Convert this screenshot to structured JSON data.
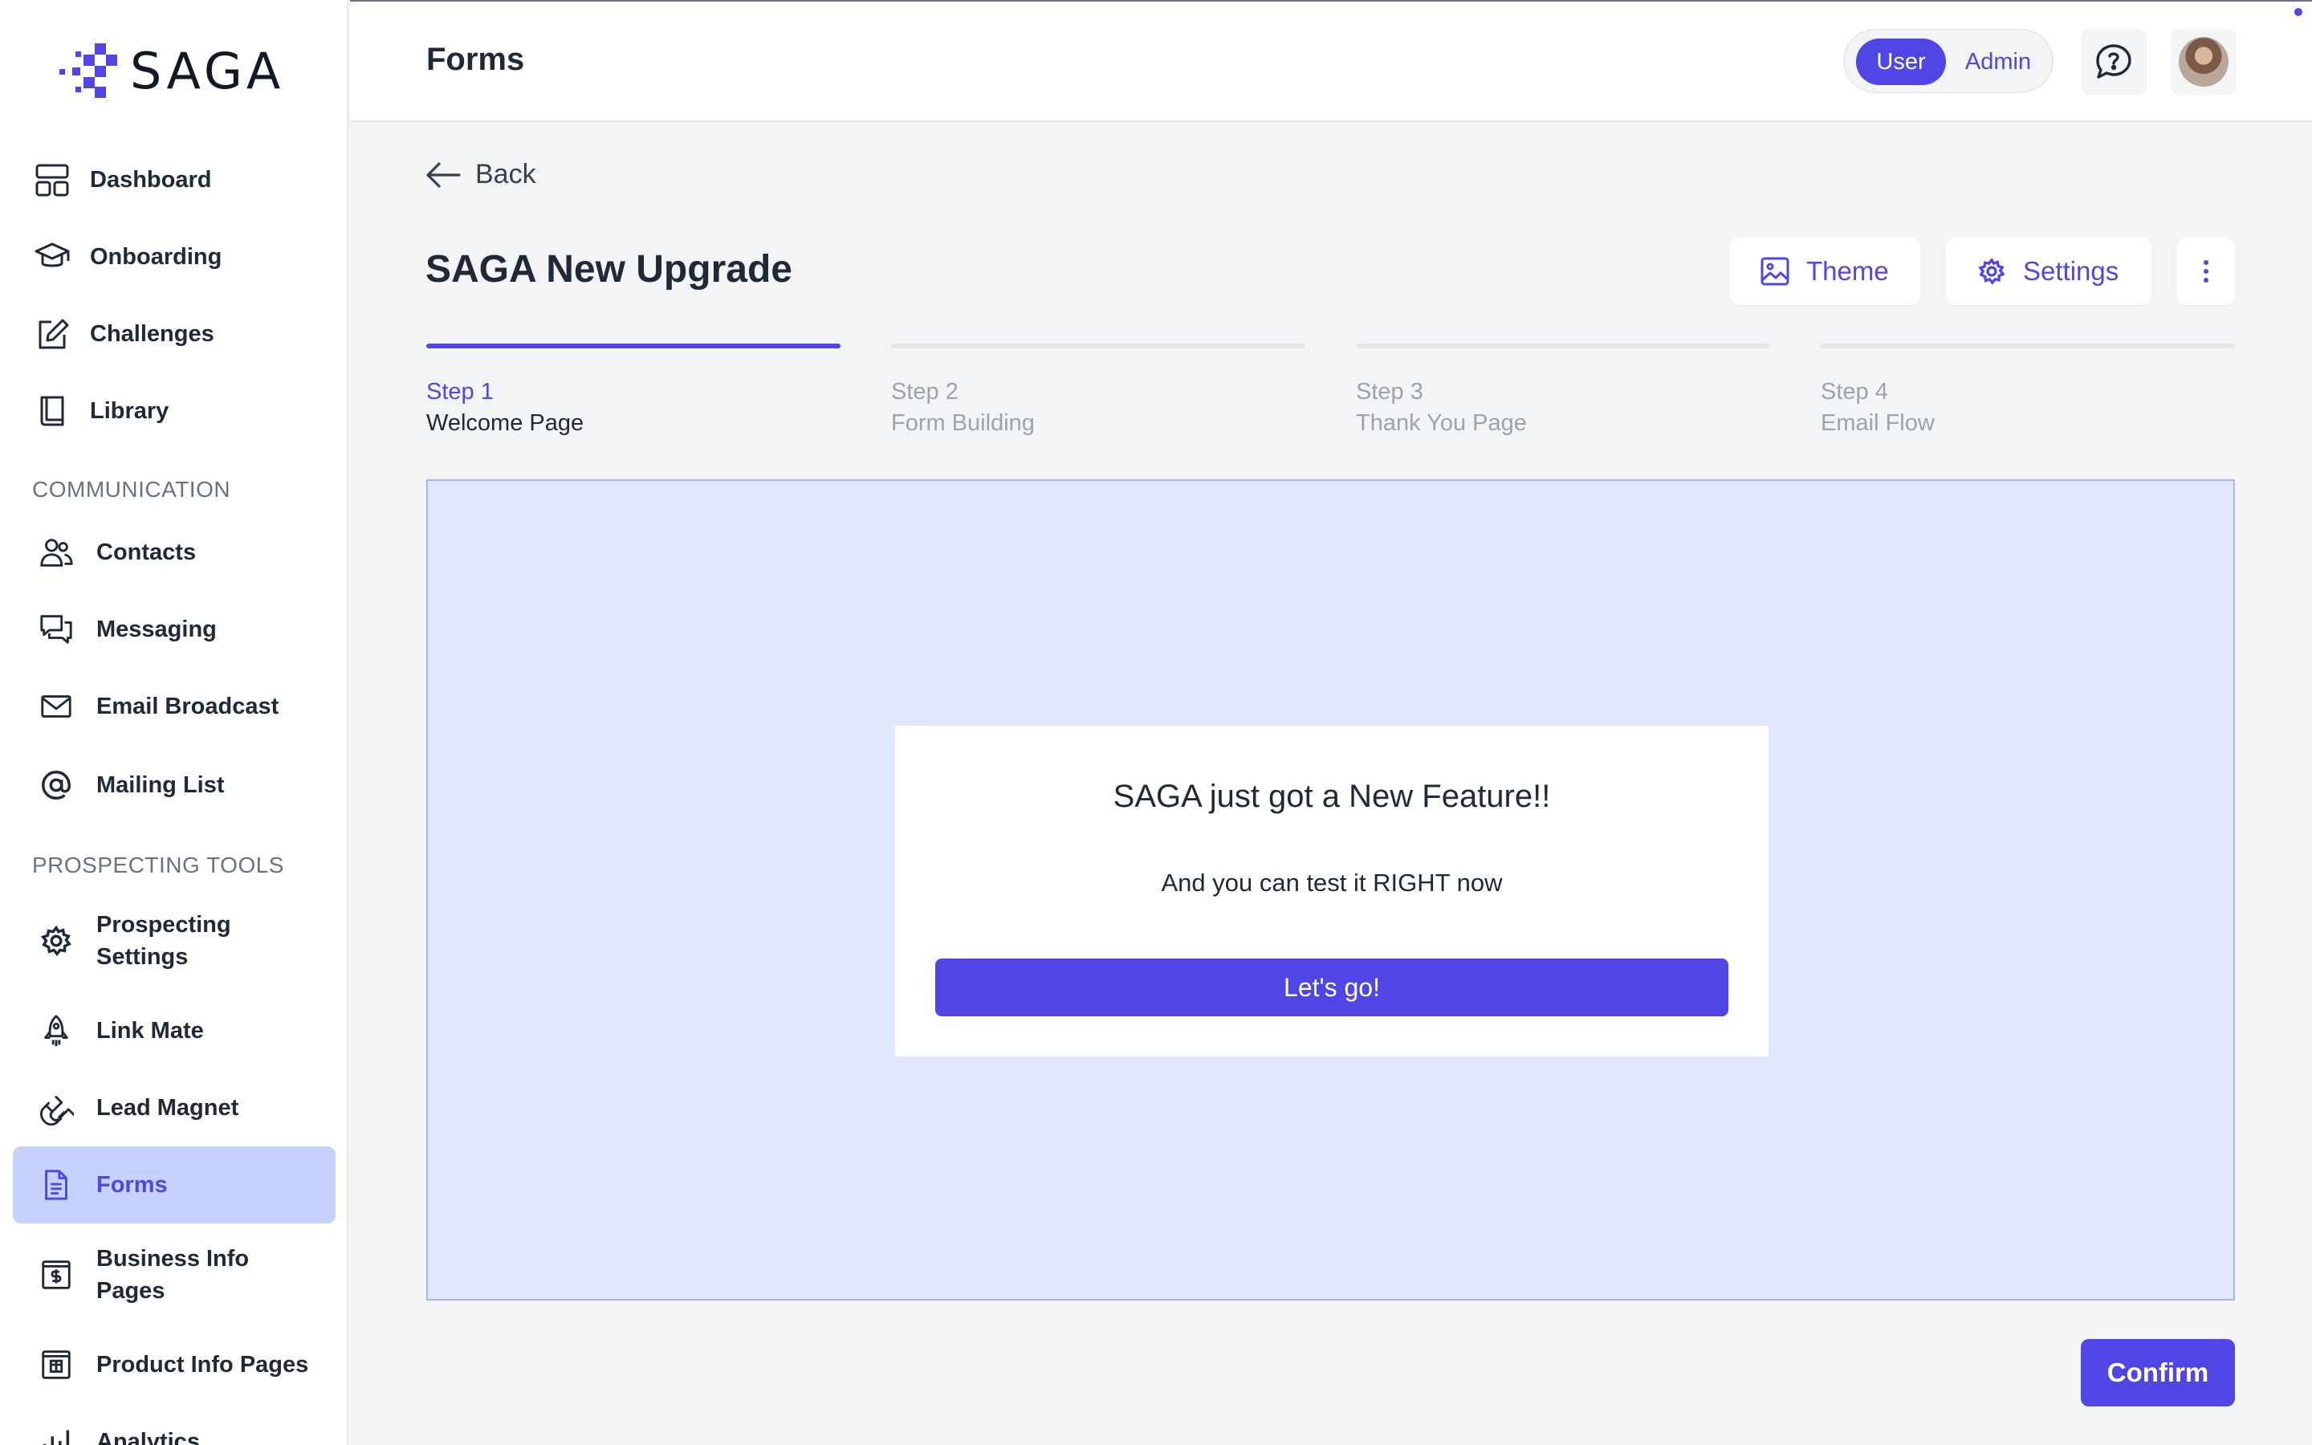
{
  "brand": {
    "name": "SAGA",
    "accent": "#4f46e5"
  },
  "sidebar": {
    "main_items": [
      {
        "label": "Dashboard",
        "icon": "dashboard-icon"
      },
      {
        "label": "Onboarding",
        "icon": "graduation-cap-icon"
      },
      {
        "label": "Challenges",
        "icon": "edit-square-icon"
      },
      {
        "label": "Library",
        "icon": "book-icon"
      }
    ],
    "communication": {
      "title": "COMMUNICATION",
      "items": [
        {
          "label": "Contacts",
          "icon": "users-icon"
        },
        {
          "label": "Messaging",
          "icon": "chat-bubbles-icon"
        },
        {
          "label": "Email Broadcast",
          "icon": "mail-icon"
        },
        {
          "label": "Mailing List",
          "icon": "at-sign-icon"
        }
      ]
    },
    "prospecting": {
      "title": "PROSPECTING TOOLS",
      "items": [
        {
          "label": "Prospecting Settings",
          "icon": "gear-icon"
        },
        {
          "label": "Link Mate",
          "icon": "rocket-icon"
        },
        {
          "label": "Lead Magnet",
          "icon": "magnet-icon"
        },
        {
          "label": "Forms",
          "icon": "document-icon",
          "active": true
        },
        {
          "label": "Business Info Pages",
          "icon": "dollar-page-icon"
        },
        {
          "label": "Product Info Pages",
          "icon": "product-page-icon"
        },
        {
          "label": "Analytics",
          "icon": "bar-chart-icon"
        }
      ]
    }
  },
  "header": {
    "title": "Forms",
    "role_toggle": {
      "user": "User",
      "admin": "Admin",
      "selected": "User"
    }
  },
  "main": {
    "back_label": "Back",
    "form_title": "SAGA New Upgrade",
    "theme_label": "Theme",
    "settings_label": "Settings",
    "steps": [
      {
        "num": "Step 1",
        "name": "Welcome Page",
        "active": true
      },
      {
        "num": "Step 2",
        "name": "Form Building"
      },
      {
        "num": "Step 3",
        "name": "Thank You Page"
      },
      {
        "num": "Step 4",
        "name": "Email Flow"
      }
    ],
    "preview": {
      "heading": "SAGA just got a New Feature!!",
      "subtext": "And you can test it RIGHT now",
      "cta": "Let's go!"
    },
    "confirm_label": "Confirm"
  }
}
